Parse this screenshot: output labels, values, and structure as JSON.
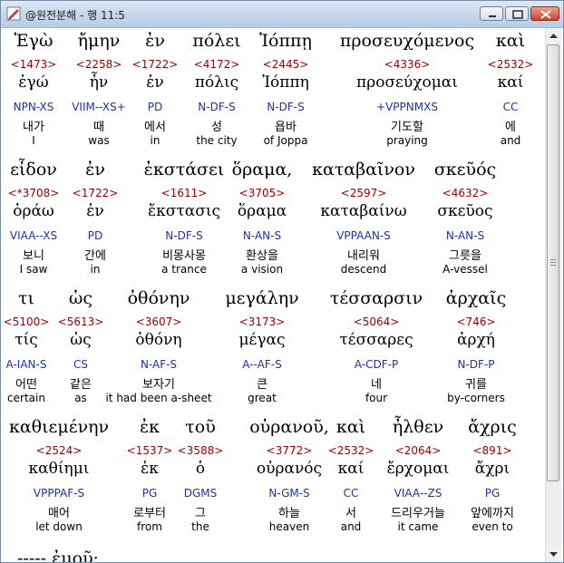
{
  "window": {
    "title": "@원전분해 - 행 11:5",
    "minimize_icon": "minimize-icon",
    "maximize_icon": "maximize-icon",
    "close_icon": "close-icon"
  },
  "rows": [
    {
      "words": [
        {
          "greek": "Ἐγὼ",
          "num": "<1473>",
          "lex": "ἐγώ",
          "morph": "NPN-XS",
          "kor": "내가",
          "eng": "I"
        },
        {
          "greek": "ἤμην",
          "num": "<2258>",
          "lex": "ἦν",
          "morph": "VIIM--XS+",
          "kor": "때",
          "eng": "was"
        },
        {
          "greek": "ἐν",
          "num": "<1722>",
          "lex": "ἐν",
          "morph": "PD",
          "kor": "에서",
          "eng": "in"
        },
        {
          "greek": "πόλει",
          "num": "<4172>",
          "lex": "πόλις",
          "morph": "N-DF-S",
          "kor": "성",
          "eng": "the city"
        },
        {
          "greek": "Ἰόππῃ",
          "num": "<2445>",
          "lex": "Ἰόππη",
          "morph": "N-DF-S",
          "kor": "욥바",
          "eng": "of Joppa"
        },
        {
          "greek": "προσευχόμενος",
          "num": "<4336>",
          "lex": "προσεύχομαι",
          "morph": "+VPPNMXS",
          "kor": "기도할",
          "eng": "praying"
        },
        {
          "greek": "καὶ",
          "num": "<2532>",
          "lex": "καί",
          "morph": "CC",
          "kor": "에",
          "eng": "and"
        }
      ]
    },
    {
      "words": [
        {
          "greek": "εἶδον",
          "num": "<*3708>",
          "lex": "ὁράω",
          "morph": "VIAA--XS",
          "kor": "보니",
          "eng": "I saw"
        },
        {
          "greek": "ἐν",
          "num": "<1722>",
          "lex": "ἐν",
          "morph": "PD",
          "kor": "간에",
          "eng": "in"
        },
        {
          "greek": "ἐκστάσει",
          "num": "<1611>",
          "lex": "ἔκστασις",
          "morph": "N-DF-S",
          "kor": "비몽사몽",
          "eng": "a trance"
        },
        {
          "greek": "ὅραμα,",
          "num": "<3705>",
          "lex": "ὅραμα",
          "morph": "N-AN-S",
          "kor": "환상을",
          "eng": "a vision"
        },
        {
          "greek": "καταβαῖνον",
          "num": "<2597>",
          "lex": "καταβαίνω",
          "morph": "VPPAAN-S",
          "kor": "내리워",
          "eng": "descend"
        },
        {
          "greek": "σκεῦός",
          "num": "<4632>",
          "lex": "σκεῦος",
          "morph": "N-AN-S",
          "kor": "그릇을",
          "eng": "A-vessel"
        }
      ]
    },
    {
      "words": [
        {
          "greek": "τι",
          "num": "<5100>",
          "lex": "τίς",
          "morph": "A-IAN-S",
          "kor": "어떤",
          "eng": "certain"
        },
        {
          "greek": "ὡς",
          "num": "<5613>",
          "lex": "ὡς",
          "morph": "CS",
          "kor": "같은",
          "eng": "as"
        },
        {
          "greek": "ὀθόνην",
          "num": "<3607>",
          "lex": "ὀθόνη",
          "morph": "N-AF-S",
          "kor": "보자기",
          "eng": "it had been a-sheet"
        },
        {
          "greek": "μεγάλην",
          "num": "<3173>",
          "lex": "μέγας",
          "morph": "A--AF-S",
          "kor": "큰",
          "eng": "great"
        },
        {
          "greek": "τέσσαρσιν",
          "num": "<5064>",
          "lex": "τέσσαρες",
          "morph": "A-CDF-P",
          "kor": "네",
          "eng": "four"
        },
        {
          "greek": "ἀρχαῖς",
          "num": "<746>",
          "lex": "ἀρχή",
          "morph": "N-DF-P",
          "kor": "귀를",
          "eng": "by-corners"
        }
      ]
    },
    {
      "words": [
        {
          "greek": "καθιεμένην",
          "num": "<2524>",
          "lex": "καθίημι",
          "morph": "VPPPAF-S",
          "kor": "매어",
          "eng": "let down"
        },
        {
          "greek": "ἐκ",
          "num": "<1537>",
          "lex": "ἐκ",
          "morph": "PG",
          "kor": "로부터",
          "eng": "from"
        },
        {
          "greek": "τοῦ",
          "num": "<3588>",
          "lex": "ὁ",
          "morph": "DGMS",
          "kor": "그",
          "eng": "the"
        },
        {
          "greek": "οὐρανοῦ,",
          "num": "<3772>",
          "lex": "οὐρανός",
          "morph": "N-GM-S",
          "kor": "하늘",
          "eng": "heaven"
        },
        {
          "greek": "καὶ",
          "num": "<2532>",
          "lex": "καί",
          "morph": "CC",
          "kor": "서",
          "eng": "and"
        },
        {
          "greek": "ἦλθεν",
          "num": "<2064>",
          "lex": "ἔρχομαι",
          "morph": "VIAA--ZS",
          "kor": "드리우거늘",
          "eng": "it came"
        },
        {
          "greek": "ἄχρις",
          "num": "<891>",
          "lex": "ἄχρι",
          "morph": "PG",
          "kor": "앞에까지",
          "eng": "even to"
        }
      ]
    }
  ],
  "tail": {
    "text": "-----   ἐμοῦ·"
  }
}
